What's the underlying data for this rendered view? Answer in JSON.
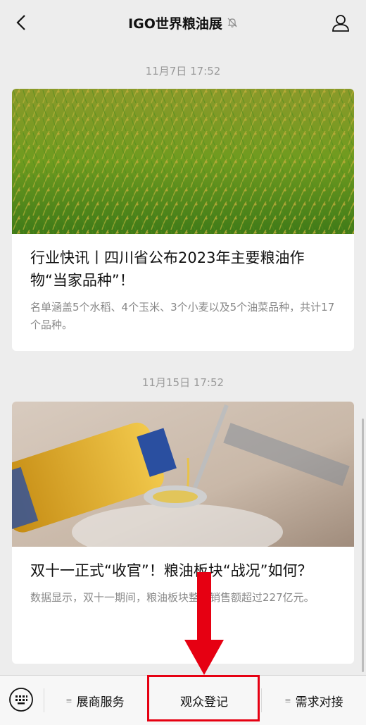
{
  "header": {
    "title": "IGO世界粮油展",
    "back_icon": "chevron-left-icon",
    "mute_icon": "bell-off-icon",
    "profile_icon": "person-icon"
  },
  "feed": {
    "messages": [
      {
        "timestamp": "11月7日 17:52",
        "image": "rice-field",
        "title": "行业快讯丨四川省公布2023年主要粮油作物“当家品种”！",
        "desc": "名单涵盖5个水稻、4个玉米、3个小麦以及5个油菜品种，共计17个品种。"
      },
      {
        "timestamp": "11月15日 17:52",
        "image": "oil-pouring",
        "title": "双十一正式“收官”！粮油板块“战况”如何？",
        "desc": "数据显示，双十一期间，粮油板块整体销售额超过227亿元。"
      }
    ]
  },
  "bottom_menu": {
    "keyboard_icon": "keyboard-icon",
    "items": [
      "展商服务",
      "观众登记",
      "需求对接"
    ]
  },
  "annotation": {
    "highlight_color": "#e60012"
  }
}
